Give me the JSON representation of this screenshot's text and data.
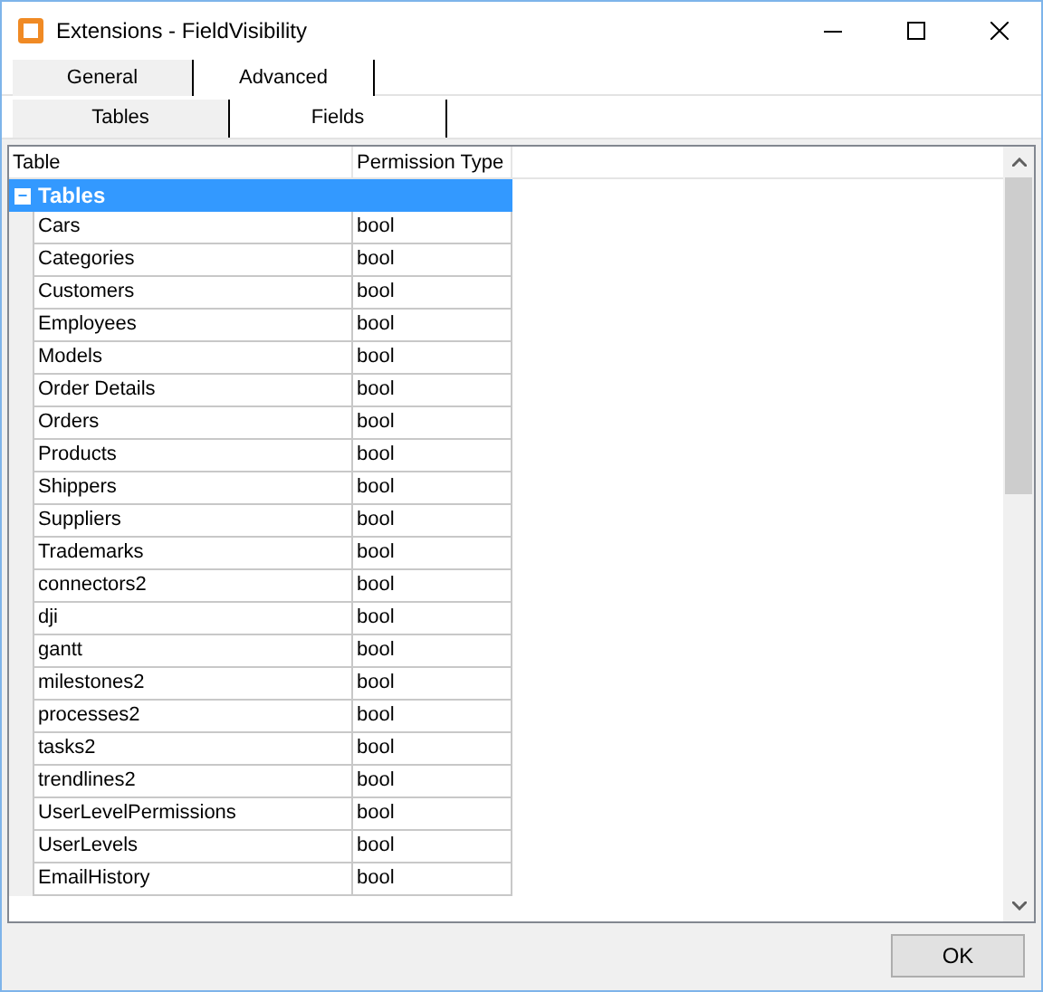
{
  "window": {
    "title": "Extensions - FieldVisibility"
  },
  "tabs": [
    {
      "label": "General",
      "selected": true
    },
    {
      "label": "Advanced",
      "selected": false
    }
  ],
  "subtabs": [
    {
      "label": "Tables",
      "selected": true
    },
    {
      "label": "Fields",
      "selected": false
    }
  ],
  "table": {
    "columns": [
      "Table",
      "Permission Type"
    ],
    "group": {
      "label": "Tables",
      "expanded": true,
      "toggle": "−"
    },
    "rows": [
      {
        "table": "Cars",
        "type": "bool"
      },
      {
        "table": "Categories",
        "type": "bool"
      },
      {
        "table": "Customers",
        "type": "bool"
      },
      {
        "table": "Employees",
        "type": "bool"
      },
      {
        "table": "Models",
        "type": "bool"
      },
      {
        "table": "Order Details",
        "type": "bool"
      },
      {
        "table": "Orders",
        "type": "bool"
      },
      {
        "table": "Products",
        "type": "bool"
      },
      {
        "table": "Shippers",
        "type": "bool"
      },
      {
        "table": "Suppliers",
        "type": "bool"
      },
      {
        "table": "Trademarks",
        "type": "bool"
      },
      {
        "table": "connectors2",
        "type": "bool"
      },
      {
        "table": "dji",
        "type": "bool"
      },
      {
        "table": "gantt",
        "type": "bool"
      },
      {
        "table": "milestones2",
        "type": "bool"
      },
      {
        "table": "processes2",
        "type": "bool"
      },
      {
        "table": "tasks2",
        "type": "bool"
      },
      {
        "table": "trendlines2",
        "type": "bool"
      },
      {
        "table": "UserLevelPermissions",
        "type": "bool"
      },
      {
        "table": "UserLevels",
        "type": "bool"
      },
      {
        "table": "EmailHistory",
        "type": "bool"
      }
    ]
  },
  "buttons": [
    "OK"
  ]
}
